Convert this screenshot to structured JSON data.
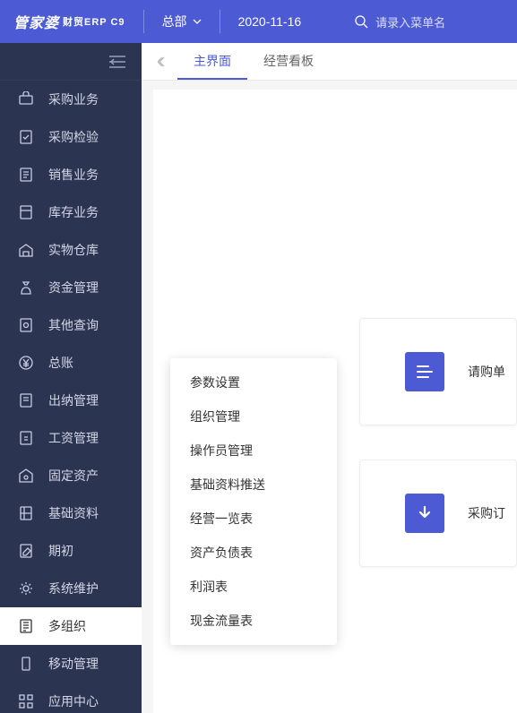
{
  "header": {
    "logo_main": "管家婆",
    "logo_sub": "财贸ERP C9",
    "org_label": "总部",
    "date": "2020-11-16",
    "search_placeholder": "请录入菜单名"
  },
  "sidebar": {
    "items": [
      {
        "label": "采购业务",
        "icon": "cart"
      },
      {
        "label": "采购检验",
        "icon": "check-doc"
      },
      {
        "label": "销售业务",
        "icon": "doc"
      },
      {
        "label": "库存业务",
        "icon": "box"
      },
      {
        "label": "实物仓库",
        "icon": "warehouse"
      },
      {
        "label": "资金管理",
        "icon": "money-bag"
      },
      {
        "label": "其他查询",
        "icon": "search-doc"
      },
      {
        "label": "总账",
        "icon": "yen"
      },
      {
        "label": "出纳管理",
        "icon": "ledger"
      },
      {
        "label": "工资管理",
        "icon": "salary"
      },
      {
        "label": "固定资产",
        "icon": "asset"
      },
      {
        "label": "基础资料",
        "icon": "data"
      },
      {
        "label": "期初",
        "icon": "edit"
      },
      {
        "label": "系统维护",
        "icon": "gear"
      },
      {
        "label": "多组织",
        "icon": "org"
      },
      {
        "label": "移动管理",
        "icon": "mobile"
      },
      {
        "label": "应用中心",
        "icon": "apps"
      }
    ],
    "active_index": 14
  },
  "tabs": {
    "items": [
      "主界面",
      "经营看板"
    ],
    "active_index": 0
  },
  "submenu": {
    "items": [
      "参数设置",
      "组织管理",
      "操作员管理",
      "基础资料推送",
      "经营一览表",
      "资产负债表",
      "利润表",
      "现金流量表"
    ]
  },
  "cards": [
    {
      "label": "请购单",
      "icon": "list"
    },
    {
      "label": "采购订",
      "icon": "download"
    }
  ]
}
